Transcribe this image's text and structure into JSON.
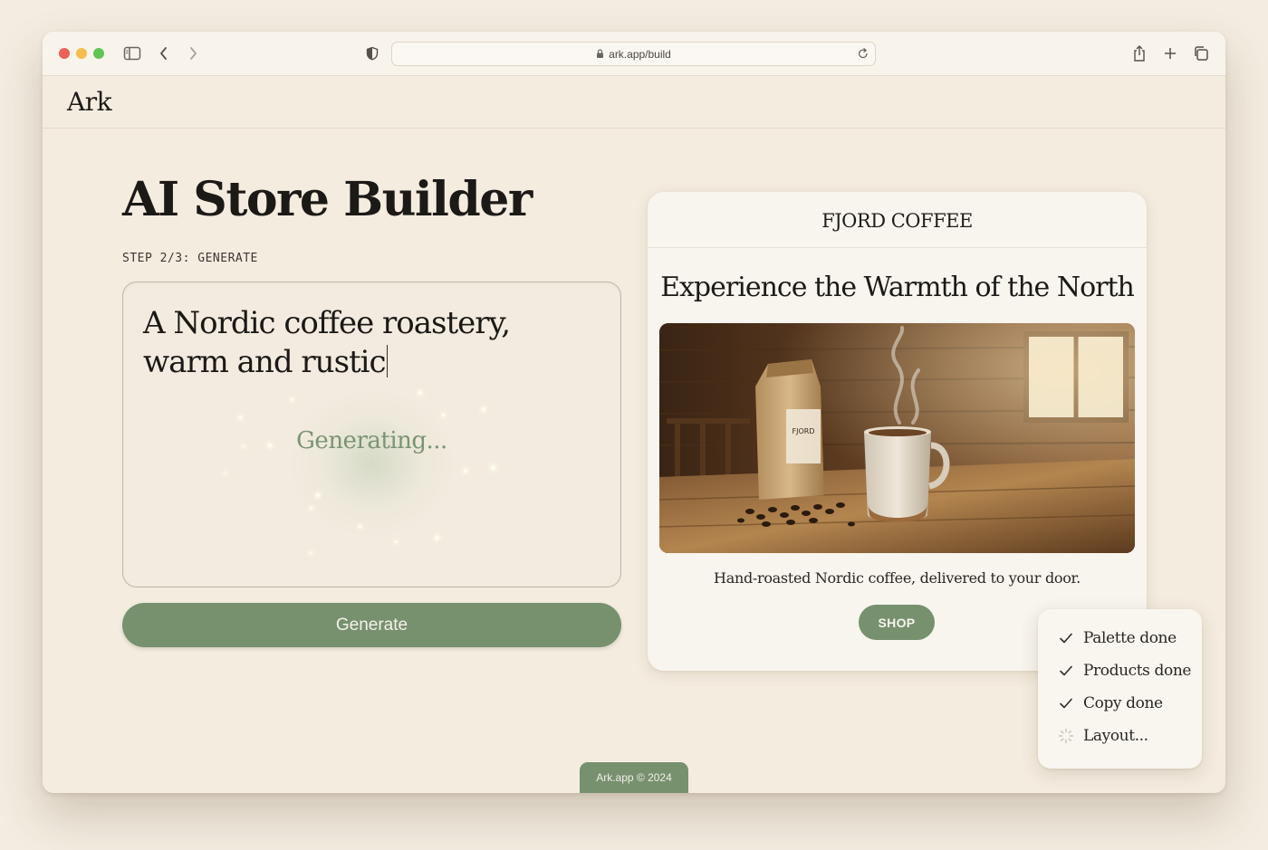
{
  "browser": {
    "url": "ark.app/build"
  },
  "site": {
    "logo": "Ark"
  },
  "builder": {
    "title": "AI Store Builder",
    "step": "STEP 2/3: GENERATE",
    "prompt_line1": "A Nordic coffee roastery,",
    "prompt_line2": "warm and rustic",
    "status": "Generating...",
    "generate_label": "Generate"
  },
  "preview": {
    "store_name": "FJORD COFFEE",
    "headline": "Experience the Warmth of the North",
    "hero_bag_label": "FJORD",
    "tagline": "Hand-roasted Nordic coffee, delivered to your door.",
    "shop_label": "SHOP"
  },
  "progress": {
    "items": [
      {
        "label": "Palette done",
        "state": "done"
      },
      {
        "label": "Products done",
        "state": "done"
      },
      {
        "label": "Copy done",
        "state": "done"
      },
      {
        "label": "Layout...",
        "state": "loading"
      }
    ]
  },
  "footer": {
    "text": "Ark.app © 2024"
  },
  "colors": {
    "accent": "#77916f",
    "background": "#f4ecdf",
    "card": "#f8f4ee"
  }
}
